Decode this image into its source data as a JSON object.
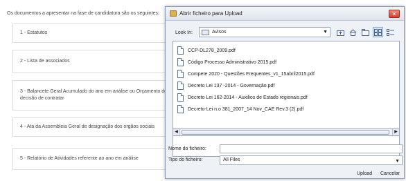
{
  "page": {
    "intro": "Os documentos a apresentar na fase de candidatura são os seguintes:",
    "rows": [
      "1 - Estatutos",
      "2 - Lista de associados",
      "3 - Balancete Geral Acumulado do ano em análise ou Orçamento de decisão de contratar",
      "4 - Ata da Assembleia Geral de designação dos orgãos sociais",
      "5 - Relatório de Atividades referente ao ano em análise"
    ]
  },
  "dialog": {
    "title": "Abrir ficheiro para Upload",
    "close_glyph": "✕",
    "look_in_label": "Look In:",
    "look_in_value": "Avisos",
    "files": [
      "CCP-DL278_2009.pdf",
      "Código Processo Administrativo 2015.pdf",
      "Compete 2020 - Questões Frequentes_v1_15abril2015.pdf",
      "Decreto Lei 137 -2014 - Governação.pdf",
      "Decreto Lei 162-2014 - Auxilios de Estado regionais.pdf",
      "Decreto-Lei n.o 381_2007_14 Nov_CAE Rev.3 (2).pdf"
    ],
    "file_name_label": "Nome do ficheiro:",
    "file_name_value": "",
    "file_type_label": "Tipo do ficheiro:",
    "file_type_value": "All Files",
    "upload_label": "Upload",
    "cancel_label": "Cancelar"
  },
  "icons": {
    "up_folder": "up-folder-icon",
    "home": "home-icon",
    "new_folder": "new-folder-icon",
    "list_view": "list-view-icon",
    "details_view": "details-view-icon"
  },
  "colors": {
    "close_button": "#d1402b",
    "dialog_bg": "#eef1f6",
    "accent_border": "#8a9bb5"
  }
}
